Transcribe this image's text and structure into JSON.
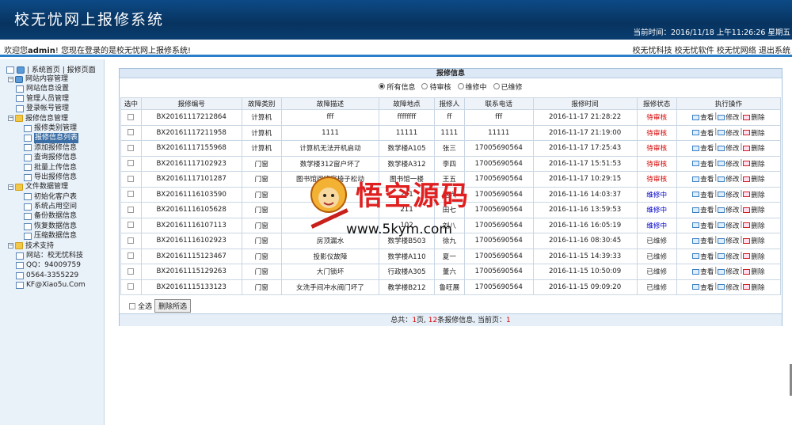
{
  "app": {
    "title": "校无忧网上报修系统",
    "clock": "当前时间：2016/11/18 上午11:26:26 星期五"
  },
  "welcome": {
    "prefix": "欢迎您",
    "user": "admin",
    "suffix": "! 您现在登录的是校无忧网上报修系统!",
    "right_links": "校无忧科技 校无忧软件 校无忧网络 退出系统"
  },
  "sidebar": {
    "top": "| 系统首页 | 报修页面",
    "tree": [
      {
        "label": "网站内容管理",
        "icon": "home-icon",
        "level": 0
      },
      {
        "label": "网站信息设置",
        "icon": "page-icon",
        "level": 1
      },
      {
        "label": "管理人员管理",
        "icon": "page-icon",
        "level": 1
      },
      {
        "label": "登录帐号管理",
        "icon": "page-icon",
        "level": 1
      },
      {
        "label": "报修信息管理",
        "icon": "folder-icon",
        "level": 0
      },
      {
        "label": "报修类别管理",
        "icon": "page-icon",
        "level": 2
      },
      {
        "label": "报修信息列表",
        "icon": "page-icon",
        "level": 2,
        "selected": true
      },
      {
        "label": "添加报修信息",
        "icon": "page-icon",
        "level": 2
      },
      {
        "label": "查询报修信息",
        "icon": "page-icon",
        "level": 2
      },
      {
        "label": "批量上传信息",
        "icon": "page-icon",
        "level": 2
      },
      {
        "label": "导出报修信息",
        "icon": "page-icon",
        "level": 2
      },
      {
        "label": "文件数据管理",
        "icon": "folder-icon",
        "level": 0
      },
      {
        "label": "初始化客户表",
        "icon": "page-icon",
        "level": 2
      },
      {
        "label": "系统占用空间",
        "icon": "page-icon",
        "level": 2
      },
      {
        "label": "备份数据信息",
        "icon": "page-icon",
        "level": 2
      },
      {
        "label": "恢复数据信息",
        "icon": "page-icon",
        "level": 2
      },
      {
        "label": "压缩数据信息",
        "icon": "page-icon",
        "level": 2
      },
      {
        "label": "技术支持",
        "icon": "folder-icon",
        "level": 0
      },
      {
        "label": "网站：校无忧科技",
        "icon": "page-icon",
        "level": 1
      },
      {
        "label": "QQ：94009759",
        "icon": "page-icon",
        "level": 1
      },
      {
        "label": "0564-3355229",
        "icon": "page-icon",
        "level": 1
      },
      {
        "label": "KF@Xiao5u.Com",
        "icon": "page-icon",
        "level": 1
      }
    ]
  },
  "panel": {
    "caption": "报修信息",
    "filters": [
      {
        "label": "所有信息",
        "checked": true
      },
      {
        "label": "待审核",
        "checked": false
      },
      {
        "label": "维修中",
        "checked": false
      },
      {
        "label": "已维修",
        "checked": false
      }
    ],
    "columns": [
      "选中",
      "报修编号",
      "故障类别",
      "故障描述",
      "故障地点",
      "报修人",
      "联系电话",
      "报修时间",
      "报修状态",
      "执行操作"
    ],
    "rows": [
      {
        "id": "BX20161117212864",
        "cat": "计算机",
        "desc": "fff",
        "place": "ffffffff",
        "person": "ff",
        "phone": "fff",
        "time": "2016-11-17 21:28:22",
        "status": "待审核",
        "kind": "pend"
      },
      {
        "id": "BX20161117211958",
        "cat": "计算机",
        "desc": "1111",
        "place": "11111",
        "person": "1111",
        "phone": "11111",
        "time": "2016-11-17 21:19:00",
        "status": "待审核",
        "kind": "pend"
      },
      {
        "id": "BX20161117155968",
        "cat": "计算机",
        "desc": "计算机无法开机启动",
        "place": "数学楼A105",
        "person": "张三",
        "phone": "17005690564",
        "time": "2016-11-17 17:25:43",
        "status": "待审核",
        "kind": "pend"
      },
      {
        "id": "BX20161117102923",
        "cat": "门窗",
        "desc": "数学楼312窗户坏了",
        "place": "数学楼A312",
        "person": "李四",
        "phone": "17005690564",
        "time": "2016-11-17 15:51:53",
        "status": "待审核",
        "kind": "pend"
      },
      {
        "id": "BX20161117101287",
        "cat": "门窗",
        "desc": "图书馆阅览室椅子松动",
        "place": "图书馆一楼",
        "person": "王五",
        "phone": "17005690564",
        "time": "2016-11-17 10:29:15",
        "status": "待审核",
        "kind": "pend"
      },
      {
        "id": "BX20161116103590",
        "cat": "门窗",
        "desc": "",
        "place": "201",
        "person": "赵六",
        "phone": "17005690564",
        "time": "2016-11-16 14:03:37",
        "status": "维修中",
        "kind": "repair"
      },
      {
        "id": "BX20161116105628",
        "cat": "门窗",
        "desc": "",
        "place": "211",
        "person": "田七",
        "phone": "17005690564",
        "time": "2016-11-16 13:59:53",
        "status": "维修中",
        "kind": "repair"
      },
      {
        "id": "BX20161116107113",
        "cat": "门窗",
        "desc": "",
        "place": "102",
        "person": "刘八",
        "phone": "17005690564",
        "time": "2016-11-16 16:05:19",
        "status": "维修中",
        "kind": "repair"
      },
      {
        "id": "BX20161116102923",
        "cat": "门窗",
        "desc": "房顶漏水",
        "place": "数学楼B503",
        "person": "徐九",
        "phone": "17005690564",
        "time": "2016-11-16 08:30:45",
        "status": "已维修",
        "kind": "done"
      },
      {
        "id": "BX20161115123467",
        "cat": "门窗",
        "desc": "投影仪故障",
        "place": "数学楼A110",
        "person": "夏一",
        "phone": "17005690564",
        "time": "2016-11-15 14:39:33",
        "status": "已维修",
        "kind": "done"
      },
      {
        "id": "BX20161115129263",
        "cat": "门窗",
        "desc": "大门锁坏",
        "place": "行政楼A305",
        "person": "董六",
        "phone": "17005690564",
        "time": "2016-11-15 10:50:09",
        "status": "已维修",
        "kind": "done"
      },
      {
        "id": "BX20161115133123",
        "cat": "门窗",
        "desc": "女洗手间冲水阀门坏了",
        "place": "教学楼B212",
        "person": "鲁旺展",
        "phone": "17005690564",
        "time": "2016-11-15 09:09:20",
        "status": "已维修",
        "kind": "done"
      }
    ],
    "ops": {
      "view": "查看",
      "edit": "修改",
      "del": "删除"
    },
    "select_all": "全选",
    "delete_selected": "删除所选",
    "footer": {
      "p1": "总共：",
      "pages": "1",
      "p2": "页, ",
      "count": "12",
      "p3": "条报修信息, 当前页：",
      "current": "1"
    }
  },
  "watermark": {
    "text": "悟空源码",
    "url": "www.5kym.com"
  },
  "colors": {
    "header": "#07335f",
    "accent": "#2b7fc9",
    "pending": "#d40000",
    "repairing": "#0000cc"
  }
}
